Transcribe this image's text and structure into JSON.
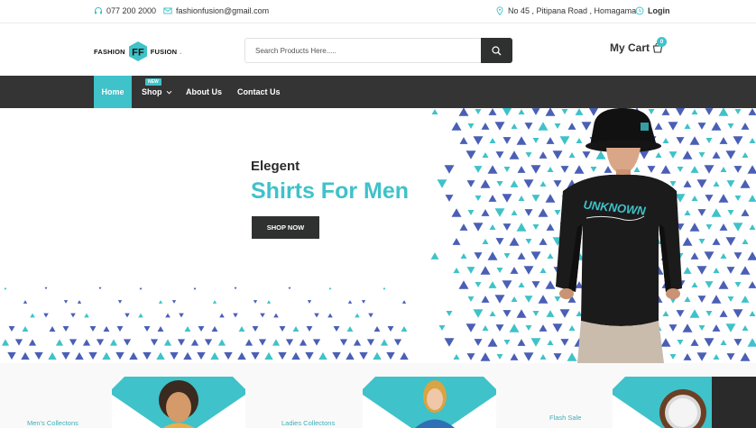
{
  "topbar": {
    "phone": "077 200 2000",
    "email": "fashionfusion@gmail.com",
    "address": "No 45 , Pitipana Road , Homagama",
    "login": "Login"
  },
  "header": {
    "logo_left": "FASHION",
    "logo_right": "FUSION",
    "logo_mark": "FF",
    "search_placeholder": "Search Products Here.....",
    "cart_label": "My Cart",
    "cart_count": "0"
  },
  "nav": {
    "items": [
      {
        "label": "Home"
      },
      {
        "label": "Shop"
      },
      {
        "label": "About Us"
      },
      {
        "label": "Contact Us"
      }
    ],
    "badge": "NEW"
  },
  "hero": {
    "kicker": "Elegent",
    "title": "Shirts For Men",
    "button": "SHOP NOW",
    "shirt_print": "UNKNOWN"
  },
  "categories": [
    {
      "label": "Men's Collectons"
    },
    {
      "label": "Ladies Collectons"
    },
    {
      "label": "Flash Sale"
    }
  ],
  "colors": {
    "accent": "#3fc2c9",
    "dark": "#343434",
    "pattern_blue": "#4a5fb5"
  },
  "icons": [
    "headset-icon",
    "mail-icon",
    "map-pin-icon",
    "clock-icon",
    "search-icon",
    "cart-icon",
    "chevron-down-icon"
  ]
}
